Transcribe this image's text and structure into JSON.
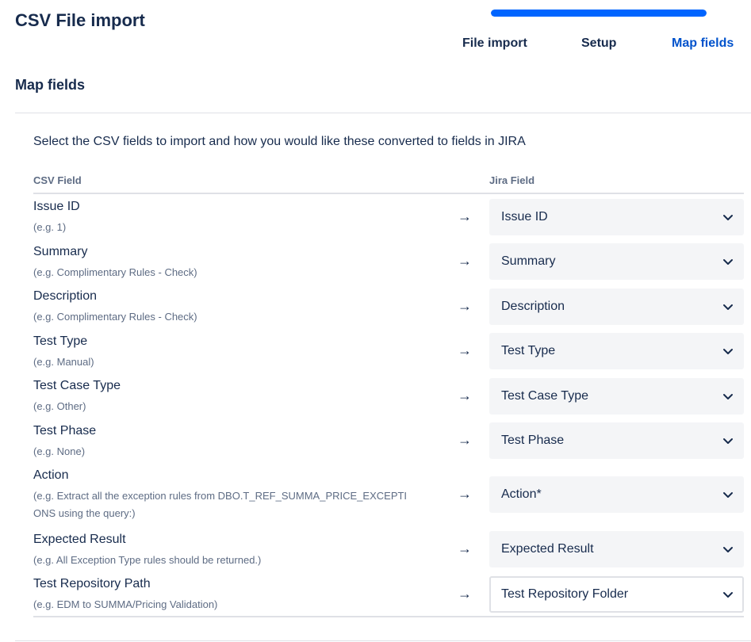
{
  "page": {
    "title": "CSV File import"
  },
  "progress": {
    "fraction": 1.0,
    "color": "#0065ff"
  },
  "steps": [
    {
      "label": "File import",
      "active": false
    },
    {
      "label": "Setup",
      "active": false
    },
    {
      "label": "Map fields",
      "active": true
    }
  ],
  "section": {
    "title": "Map fields",
    "intro": "Select the CSV fields to import and how you would like these converted to fields in JIRA"
  },
  "table": {
    "csv_header": "CSV Field",
    "jira_header": "Jira Field",
    "arrow": "→",
    "rows": [
      {
        "csv_field": "Issue ID",
        "example": "(e.g. 1)",
        "jira_field": "Issue ID"
      },
      {
        "csv_field": "Summary",
        "example": "(e.g. Complimentary Rules - Check)",
        "jira_field": "Summary"
      },
      {
        "csv_field": "Description",
        "example": "(e.g. Complimentary Rules - Check)",
        "jira_field": "Description"
      },
      {
        "csv_field": "Test Type",
        "example": "(e.g. Manual)",
        "jira_field": "Test Type"
      },
      {
        "csv_field": "Test Case Type",
        "example": "(e.g. Other)",
        "jira_field": "Test Case Type"
      },
      {
        "csv_field": "Test Phase",
        "example": "(e.g. None)",
        "jira_field": "Test Phase"
      },
      {
        "csv_field": "Action",
        "example": "(e.g. Extract all the exception rules from DBO.T_REF_SUMMA_PRICE_EXCEPTIONS using the query:)",
        "jira_field": "Action*"
      },
      {
        "csv_field": "Expected Result",
        "example": "(e.g. All Exception Type rules should be returned.)",
        "jira_field": "Expected Result"
      },
      {
        "csv_field": "Test Repository Path",
        "example": "(e.g. EDM to SUMMA/Pricing Validation)",
        "jira_field": "Test Repository Folder"
      }
    ]
  },
  "colors": {
    "text": "#172b4d",
    "subtle": "#5e6c84",
    "active_step": "#0052cc",
    "select_bg": "#f4f5f7"
  },
  "icons": {
    "dropdown": "chevron-down-icon"
  }
}
